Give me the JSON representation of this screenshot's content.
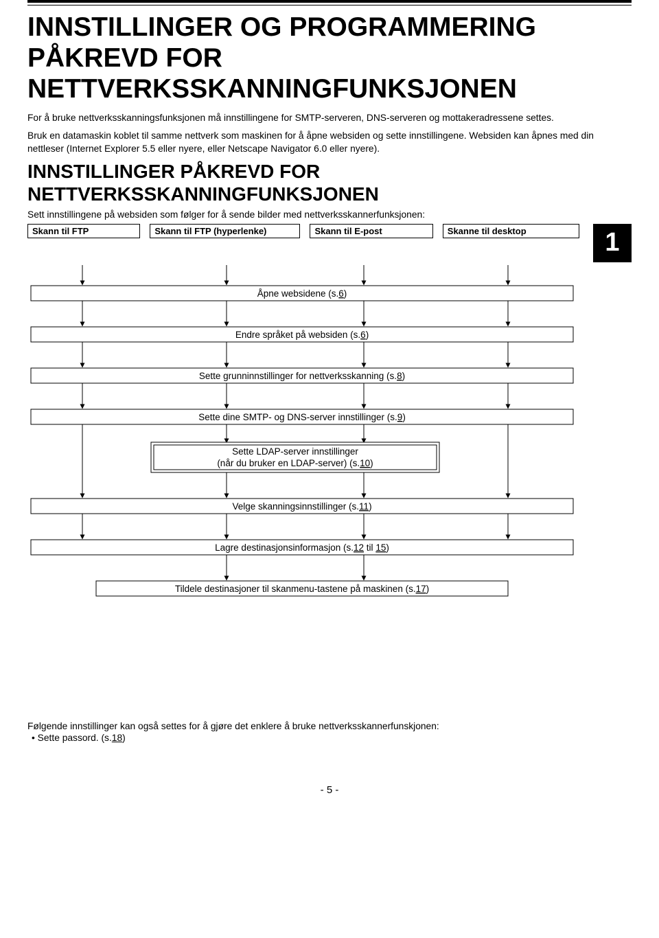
{
  "title": "INNSTILLINGER OG PROGRAMMERING PÅKREVD FOR NETTVERKSSKANNINGFUNKSJONEN",
  "intro1": "For å bruke nettverksskanningsfunksjonen må innstillingene for SMTP-serveren, DNS-serveren og mottakeradressene settes.",
  "intro2": "Bruk en datamaskin koblet til samme nettverk som maskinen for å åpne websiden og sette innstillingene. Websiden kan åpnes med din nettleser (Internet Explorer 5.5 eller nyere, eller Netscape Navigator 6.0 eller nyere).",
  "section_title": "INNSTILLINGER PÅKREVD FOR NETTVERKSSKANNINGFUNKSJONEN",
  "sub_intro": "Sett innstillingene på websiden som følger for å sende bilder med nettverksskannerfunksjonen:",
  "chapter_number": "1",
  "heads": {
    "col1": "Skann til FTP",
    "col2": "Skann til FTP (hyperlenke)",
    "col3": "Skann til E-post",
    "col4": "Skanne til desktop"
  },
  "steps": {
    "s1": {
      "text": "Åpne websidene (s.",
      "link": "6",
      "after": ")"
    },
    "s2": {
      "text": "Endre språket på websiden (s.",
      "link": "6",
      "after": ")"
    },
    "s3": {
      "text": "Sette grunninnstillinger for nettverksskanning (s.",
      "link": "8",
      "after": ")"
    },
    "s4": {
      "text": "Sette dine SMTP- og DNS-server innstillinger (s.",
      "link": "9",
      "after": ")"
    },
    "s5": {
      "line1": "Sette LDAP-server innstillinger",
      "line2_pre": "(når du bruker en LDAP-server) (s.",
      "link": "10",
      "after": ")"
    },
    "s6": {
      "text": "Velge skanningsinnstillinger (s.",
      "link": "11",
      "after": ")"
    },
    "s7": {
      "text": "Lagre destinasjonsinformasjon (s.",
      "link": "12",
      "mid": " til ",
      "link2": "15",
      "after": ")"
    },
    "s8": {
      "text": "Tildele destinasjoner til skanmenu-tastene på maskinen (s.",
      "link": "17",
      "after": ")"
    }
  },
  "footer": "Følgende innstillinger kan også settes for å gjøre det enklere å bruke nettverksskannerfunskjonen:",
  "bullet_pre": "• Sette passord. (s.",
  "bullet_link": "18",
  "bullet_after": ")",
  "page_number": "- 5 -"
}
